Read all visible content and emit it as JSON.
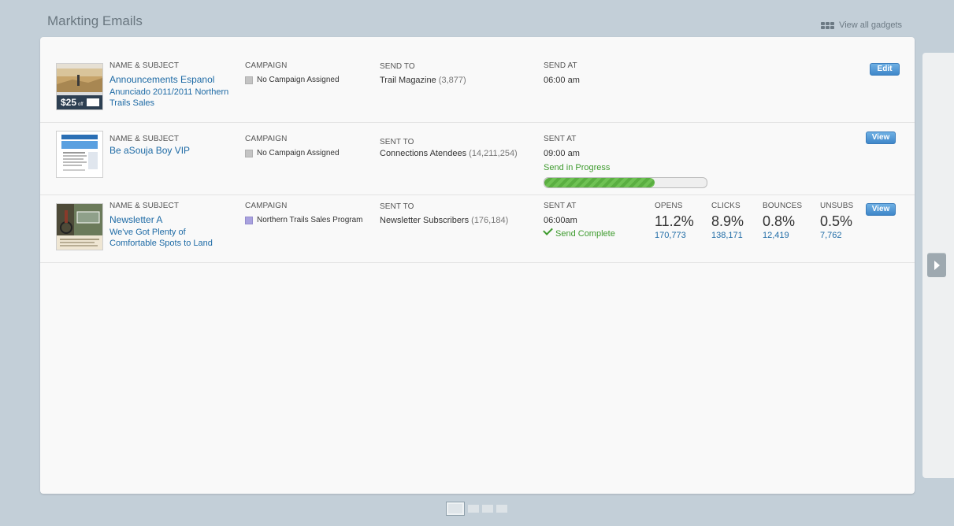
{
  "header": {
    "title": "Markting Emails",
    "view_all": "View all gadgets"
  },
  "rows": [
    {
      "name_label": "NAME & SUBJECT",
      "name": "Announcements Espanol",
      "subject": "Anunciado 2011/2011 Northern Trails Sales",
      "campaign_label": "CAMPAIGN",
      "campaign": "No Campaign Assigned",
      "send_label": "SEND TO",
      "send_to": "Trail Magazine",
      "send_count": "(3,877)",
      "time_label": "SEND AT",
      "time": "06:00 am",
      "button": "Edit"
    },
    {
      "name_label": "NAME & SUBJECT",
      "name": "Be aSouja Boy VIP",
      "campaign_label": "CAMPAIGN",
      "campaign": "No Campaign Assigned",
      "send_label": "SENT TO",
      "send_to": "Connections Atendees",
      "send_count": "(14,211,254)",
      "time_label": "SENT AT",
      "time": "09:00 am",
      "status": "Send in Progress",
      "progress": 0.68,
      "button": "View"
    },
    {
      "name_label": "NAME & SUBJECT",
      "name": "Newsletter A",
      "subject": "We've Got Plenty of Comfortable Spots to Land",
      "campaign_label": "CAMPAIGN",
      "campaign": "Northern Trails Sales Program",
      "send_label": "SENT TO",
      "send_to": "Newsletter Subscribers",
      "send_count": "(176,184)",
      "time_label": "SENT AT",
      "time": "06:00am",
      "status": "Send Complete",
      "stats": [
        {
          "label": "OPENS",
          "value": "11.2%",
          "count": "170,773"
        },
        {
          "label": "CLICKS",
          "value": "8.9%",
          "count": "138,171"
        },
        {
          "label": "BOUNCES",
          "value": "0.8%",
          "count": "12,419"
        },
        {
          "label": "UNSUBS",
          "value": "0.5%",
          "count": "7,762"
        }
      ],
      "button": "View"
    }
  ],
  "thumb_promo": "$25",
  "thumb_promo_suffix": "off",
  "pager": {
    "pages": 4,
    "active": 1
  }
}
